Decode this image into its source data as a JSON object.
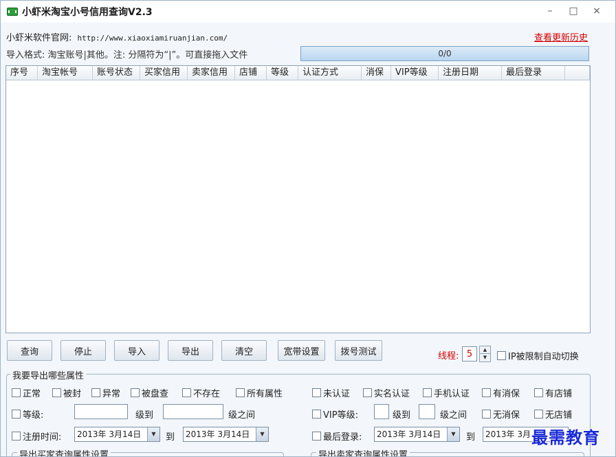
{
  "window": {
    "title": "小虾米淘宝小号信用查询V2.3",
    "minimize": "–",
    "maximize": "□",
    "close": "×"
  },
  "header": {
    "site_label": "小虾米软件官网:",
    "site_url": "http://www.xiaoxiamiruanjian.com/",
    "history_link": "查看更新历史",
    "import_note": "导入格式: 淘宝账号|其他。注: 分隔符为“|”。可直接拖入文件",
    "progress_text": "0/0"
  },
  "table": {
    "columns": [
      "序号",
      "淘宝帐号",
      "账号状态",
      "买家信用",
      "卖家信用",
      "店铺",
      "等级",
      "认证方式",
      "消保",
      "VIP等级",
      "注册日期",
      "最后登录"
    ]
  },
  "toolbar": {
    "query": "查询",
    "stop": "停止",
    "import": "导入",
    "export": "导出",
    "clear": "清空",
    "broadband": "宽带设置",
    "dial_test": "拨号测试",
    "threads_label": "线程:",
    "threads_value": "5",
    "ip_switch": "IP被限制自动切换"
  },
  "export_group": {
    "title": "我要导出哪些属性",
    "row1_left": [
      "正常",
      "被封",
      "异常",
      "被盘查",
      "不存在",
      "所有属性"
    ],
    "row1_right": [
      "未认证",
      "实名认证",
      "手机认证",
      "有消保",
      "有店铺"
    ],
    "level_label": "等级:",
    "level_to": "级到",
    "level_between": "级之间",
    "vip_label": "VIP等级:",
    "vip_to": "级到",
    "vip_between": "级之间",
    "no_xiaobao": "无消保",
    "no_shop": "无店铺",
    "reg_time_label": "注册时间:",
    "reg_from": "2013年 3月14日",
    "reg_to_word": "到",
    "reg_to": "2013年 3月14日",
    "last_login_label": "最后登录:",
    "last_from": "2013年 3月14日",
    "last_to_word": "到",
    "last_to": "2013年 3月",
    "buyer_group": "导出买家查询属性设置",
    "seller_group": "导出卖家查询属性设置"
  },
  "watermark": "最需教育"
}
